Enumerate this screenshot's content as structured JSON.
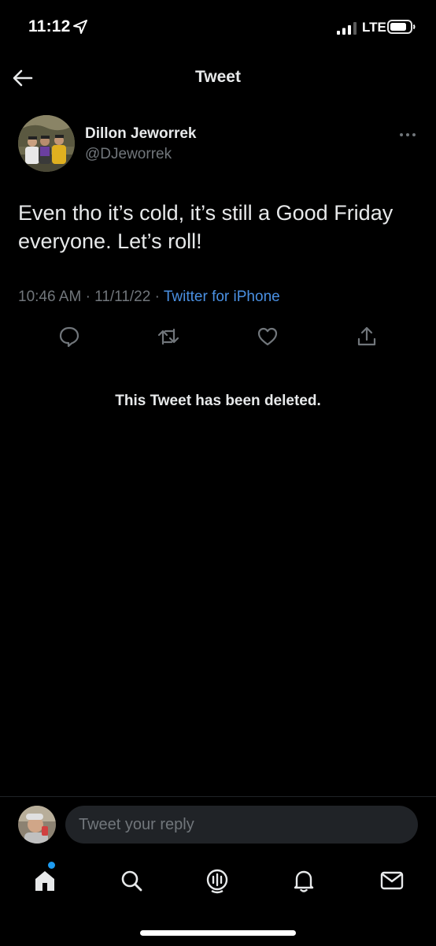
{
  "status_bar": {
    "time": "11:12",
    "carrier": "LTE"
  },
  "header": {
    "title": "Tweet"
  },
  "tweet": {
    "author": {
      "name": "Dillon Jeworrek",
      "handle": "@DJeworrek"
    },
    "text": "Even tho it’s cold, it’s still a Good Friday everyone. Let’s roll!",
    "time": "10:46 AM",
    "separator": "·",
    "date": "11/11/22",
    "source": "Twitter for iPhone",
    "actions": [
      "reply-icon",
      "retweet-icon",
      "like-icon",
      "share-icon"
    ]
  },
  "quoted": {
    "deleted_notice": "This Tweet has been deleted."
  },
  "reply": {
    "placeholder": "Tweet your reply"
  },
  "tab_bar": {
    "items": [
      "home-icon",
      "search-icon",
      "spaces-icon",
      "notifications-icon",
      "messages-icon"
    ]
  },
  "colors": {
    "background": "#000000",
    "text_primary": "#e7e9ea",
    "text_secondary": "#71767b",
    "link": "#4a90e2",
    "accent": "#1d9bf0"
  }
}
